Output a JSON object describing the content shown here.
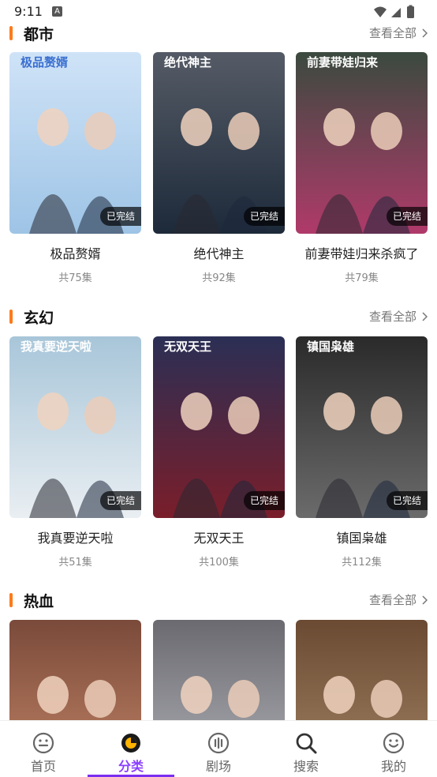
{
  "status_bar": {
    "time": "9:11",
    "notification_letter": "A"
  },
  "sections": [
    {
      "title": "都市",
      "more_label": "查看全部",
      "items": [
        {
          "name": "极品赘婿",
          "episodes": "共75集",
          "badge": "已完结",
          "poster_text": "极品赘婿",
          "poster_color": "#cfe3f7",
          "poster_color2": "#9ec4e6"
        },
        {
          "name": "绝代神主",
          "episodes": "共92集",
          "badge": "已完结",
          "poster_text": "绝代神主",
          "poster_color": "#555b66",
          "poster_color2": "#1d2a3a"
        },
        {
          "name": "前妻带娃归来杀疯了",
          "episodes": "共79集",
          "badge": "已完结",
          "poster_text": "前妻带娃归来",
          "poster_color": "#3b4a3f",
          "poster_color2": "#b03a6a"
        }
      ]
    },
    {
      "title": "玄幻",
      "more_label": "查看全部",
      "items": [
        {
          "name": "我真要逆天啦",
          "episodes": "共51集",
          "badge": "已完结",
          "poster_text": "我真要逆天啦",
          "poster_color": "#a8c6d9",
          "poster_color2": "#e9eef2"
        },
        {
          "name": "无双天王",
          "episodes": "共100集",
          "badge": "已完结",
          "poster_text": "无双天王",
          "poster_color": "#2b2f55",
          "poster_color2": "#7a1e2a"
        },
        {
          "name": "镇国枭雄",
          "episodes": "共112集",
          "badge": "已完结",
          "poster_text": "镇国枭雄",
          "poster_color": "#2a2a2a",
          "poster_color2": "#6b6b6b"
        }
      ]
    },
    {
      "title": "热血",
      "more_label": "查看全部",
      "items": [
        {
          "name": "",
          "episodes": "",
          "badge": "",
          "poster_text": "",
          "poster_color": "#7a4a3a",
          "poster_color2": "#c98a6a"
        },
        {
          "name": "",
          "episodes": "",
          "badge": "",
          "poster_text": "",
          "poster_color": "#6a6a70",
          "poster_color2": "#b9b9c0"
        },
        {
          "name": "",
          "episodes": "",
          "badge": "",
          "poster_text": "",
          "poster_color": "#6a4a32",
          "poster_color2": "#a98a6a"
        }
      ]
    }
  ],
  "bottom_nav": [
    {
      "label": "首页",
      "icon": "home-face-icon",
      "active": false
    },
    {
      "label": "分类",
      "icon": "category-icon",
      "active": true
    },
    {
      "label": "剧场",
      "icon": "theater-icon",
      "active": false
    },
    {
      "label": "搜索",
      "icon": "search-icon",
      "active": false
    },
    {
      "label": "我的",
      "icon": "profile-icon",
      "active": false
    }
  ],
  "colors": {
    "accent": "#ff7a1a",
    "active_nav": "#8a3fff"
  }
}
